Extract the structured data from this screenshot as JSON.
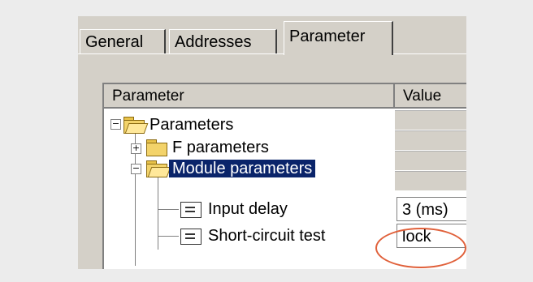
{
  "tabs": [
    {
      "label": "General"
    },
    {
      "label": "Addresses"
    },
    {
      "label": "Parameter"
    }
  ],
  "table": {
    "columns": [
      "Parameter",
      "Value"
    ],
    "tree": {
      "root": {
        "label": "Parameters"
      },
      "f_params": {
        "label": "F parameters"
      },
      "module": {
        "label": "Module parameters"
      },
      "input_delay": {
        "label": "Input delay",
        "value": "3 (ms)"
      },
      "short_circuit": {
        "label": "Short-circuit test",
        "value": "lock"
      }
    }
  },
  "colors": {
    "selection": "#0a246a",
    "annotation_circle": "#e0603a"
  }
}
